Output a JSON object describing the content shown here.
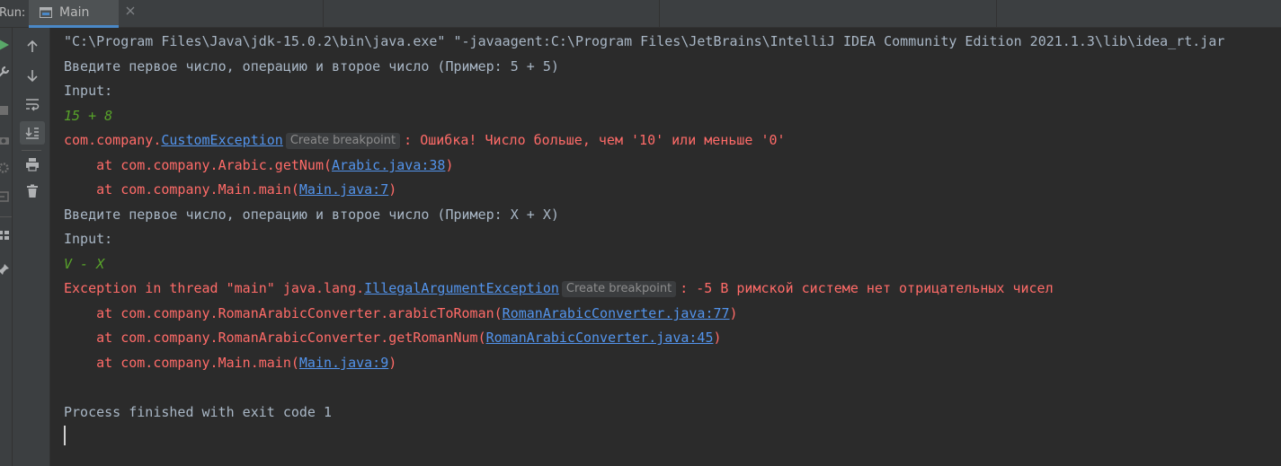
{
  "window": {
    "run_label": "Run:",
    "tab_label": "Main"
  },
  "colors": {
    "background": "#2b2b2b",
    "toolbar": "#3c3f41",
    "stdout": "#a9b7c6",
    "stderr": "#ff6b68",
    "stdin": "#58a32a",
    "link": "#5394ec",
    "run_green": "#59a869"
  },
  "toolbar": {
    "buttons": [
      {
        "name": "up-arrow-icon",
        "label": "Up the stack trace"
      },
      {
        "name": "down-arrow-icon",
        "label": "Down the stack trace"
      },
      {
        "name": "soft-wrap-icon",
        "label": "Soft-wrap"
      },
      {
        "name": "scroll-to-end-icon",
        "label": "Scroll to the end",
        "active": true
      },
      {
        "name": "print-icon",
        "label": "Print"
      },
      {
        "name": "trash-icon",
        "label": "Clear all"
      }
    ]
  },
  "console": {
    "line1": "\"C:\\Program Files\\Java\\jdk-15.0.2\\bin\\java.exe\" \"-javaagent:C:\\Program Files\\JetBrains\\IntelliJ IDEA Community Edition 2021.1.3\\lib\\idea_rt.jar",
    "line2": "Введите первое число, операцию и второе число (Пример: 5 + 5)",
    "line3": "Input:",
    "line4": "15 + 8",
    "line5_pre": "com.company.",
    "line5_link": "CustomException",
    "line5_hint": "Create breakpoint",
    "line5_post": ": Ошибка! Число больше, чем '10' или меньше '0'",
    "line6_pre": "    at com.company.Arabic.getNum(",
    "line6_link": "Arabic.java:38",
    "line6_post": ")",
    "line7_pre": "    at com.company.Main.main(",
    "line7_link": "Main.java:7",
    "line7_post": ")",
    "line8": "Введите первое число, операцию и второе число (Пример: X + X)",
    "line9": "Input:",
    "line10": "V - X",
    "line11_pre": "Exception in thread \"main\" java.lang.",
    "line11_link": "IllegalArgumentException",
    "line11_hint": "Create breakpoint",
    "line11_post": ": -5 В римской системе нет отрицательных чисел",
    "line12_pre": "    at com.company.RomanArabicConverter.arabicToRoman(",
    "line12_link": "RomanArabicConverter.java:77",
    "line12_post": ")",
    "line13_pre": "    at com.company.RomanArabicConverter.getRomanNum(",
    "line13_link": "RomanArabicConverter.java:45",
    "line13_post": ")",
    "line14_pre": "    at com.company.Main.main(",
    "line14_link": "Main.java:9",
    "line14_post": ")",
    "line16": "Process finished with exit code 1"
  }
}
